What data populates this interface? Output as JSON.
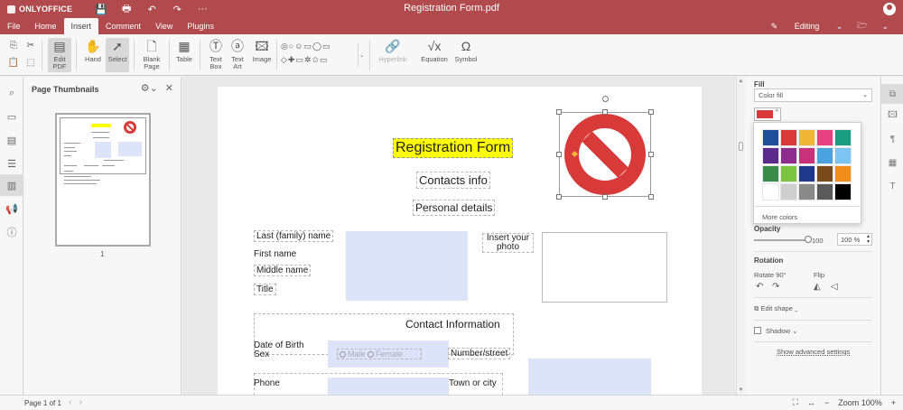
{
  "app": {
    "brand": "ONLYOFFICE",
    "doc_title": "Registration Form.pdf"
  },
  "quick": {
    "save": "💾",
    "print": "🖶",
    "undo": "↶",
    "redo": "↷",
    "more": "···"
  },
  "menu": {
    "tabs": [
      "File",
      "Home",
      "Insert",
      "Comment",
      "View",
      "Plugins"
    ],
    "active": "Insert",
    "mode": "Editing",
    "mode_icon": "✎",
    "open_location": "🗁",
    "expand": "⌄"
  },
  "toolbar": {
    "edit_pdf": "Edit PDF",
    "hand": "Hand",
    "select": "Select",
    "blank_page": "Blank Page",
    "table": "Table",
    "text_box": "Text Box",
    "text_art": "Text Art",
    "image": "Image",
    "hyperlink": "Hyperlink",
    "equation": "Equation",
    "symbol": "Symbol",
    "shapes_glyphs": "◎○☺▭◯▭ ◇✚▭✲✩▭"
  },
  "thumbnails": {
    "title": "Page Thumbnails",
    "page_number": "1"
  },
  "document": {
    "title": "Registration Form",
    "section_contacts": "Contacts info",
    "section_personal": "Personal details",
    "labels": {
      "last_name": "Last (family) name",
      "first_name": "First name",
      "middle_name": "Middle name",
      "title": "Title",
      "insert_photo": "Insert your photo",
      "contact_info": "Contact Information",
      "dob": "Date of Birth",
      "sex": "Sex",
      "male": "Male",
      "female": "Female",
      "number_street": "Number/street",
      "phone": "Phone",
      "town": "Town or city"
    }
  },
  "right_panel": {
    "fill_label": "Fill",
    "fill_type": "Color fill",
    "opacity_label": "Opacity",
    "opacity_value": "100",
    "opacity_percent": "100 %",
    "rotation_label": "Rotation",
    "rotate_label": "Rotate 90°",
    "flip_label": "Flip",
    "edit_shape": "Edit shape",
    "shadow": "Shadow",
    "advanced": "Show advanced settings"
  },
  "color_picker": {
    "more_colors": "More colors",
    "selected": "#d83a3a",
    "colors": [
      "#1f4e9a",
      "#d83a3a",
      "#f2b636",
      "#e8417f",
      "#1a9c7e",
      "#5b2a8c",
      "#8e2b8c",
      "#c8327a",
      "#4aa3df",
      "#7cc4f2",
      "#3a8a4a",
      "#7dc441",
      "#1f3a8a",
      "#7a4a1a",
      "#f28c1a",
      "#ffffff",
      "#cfcfcf",
      "#8a8a8a",
      "#5a5a5a",
      "#000000"
    ]
  },
  "status": {
    "page": "Page 1 of 1",
    "zoom": "Zoom 100%",
    "prev": "‹",
    "next": "›"
  }
}
